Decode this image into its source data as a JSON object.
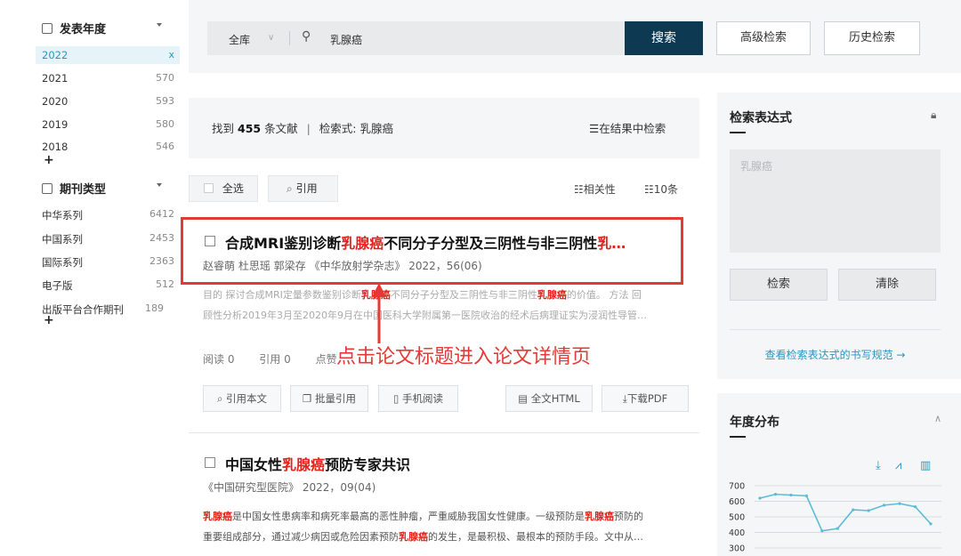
{
  "sidebar": {
    "pub_year": {
      "title": "发表年度",
      "items": [
        {
          "label": "2022",
          "count": "x"
        },
        {
          "label": "2021",
          "count": "570"
        },
        {
          "label": "2020",
          "count": "593"
        },
        {
          "label": "2019",
          "count": "580"
        },
        {
          "label": "2018",
          "count": "546"
        }
      ],
      "more": "+"
    },
    "journal_type": {
      "title": "期刊类型",
      "items": [
        {
          "label": "中华系列",
          "count": "6412"
        },
        {
          "label": "中国系列",
          "count": "2453"
        },
        {
          "label": "国际系列",
          "count": "2363"
        },
        {
          "label": "电子版",
          "count": "512"
        },
        {
          "label": "出版平台合作期刊",
          "count": "189"
        }
      ],
      "more": "+"
    }
  },
  "search": {
    "scope": "全库",
    "query": "乳腺癌",
    "button": "搜索",
    "advanced": "高级检索",
    "history": "历史检索"
  },
  "summary": {
    "found_prefix": "找到",
    "count": "455",
    "found_suffix": "条文献",
    "sep": "|",
    "expr": "检索式: 乳腺癌",
    "within": "在结果中检索"
  },
  "toolbar": {
    "select_all": "全选",
    "cite": "引用",
    "relevance": "相关性",
    "per_page": "10条"
  },
  "results": [
    {
      "title_pre": "合成MRI鉴别诊断",
      "title_hl": "乳腺癌",
      "title_mid": "不同分子分型及三阴性与非三阴性",
      "title_hl2": "乳…",
      "meta": "赵睿萌  杜思瑶  郭梁存  《中华放射学杂志》 2022，56(06)",
      "abstract_1_pre": "目的 探讨合成MRI定量参数鉴别诊断",
      "abstract_1_hl": "乳腺癌",
      "abstract_1_mid": "不同分子分型及三阴性与非三阴性",
      "abstract_1_hl2": "乳腺癌",
      "abstract_1_post": "的价值。 方法 回",
      "abstract_2": "顾性分析2019年3月至2020年9月在中国医科大学附属第一医院收治的经术后病理证实为浸润性导管…",
      "stats_read": "阅读 0",
      "stats_cite": "引用 0",
      "stats_fav": "点赞",
      "actions": {
        "cite": "引用本文",
        "batch": "批量引用",
        "mobile": "手机阅读",
        "html": "全文HTML",
        "pdf": "下载PDF"
      }
    },
    {
      "title_pre": "中国女性",
      "title_hl": "乳腺癌",
      "title_post": "预防专家共识",
      "meta": "《中国研究型医院》 2022，09(04)",
      "abstract_1_hl": "乳腺癌",
      "abstract_1_post": "是中国女性患病率和病死率最高的恶性肿瘤，严重威胁我国女性健康。一级预防是",
      "abstract_1_hl2": "乳腺癌",
      "abstract_1_post2": "预防的",
      "abstract_2_pre": "重要组成部分，通过减少病因或危险因素预防",
      "abstract_2_hl": "乳腺癌",
      "abstract_2_post": "的发生，是最积极、最根本的预防手段。文中从…"
    }
  ],
  "annotation": "点击论文标题进入论文详情页",
  "right_panel": {
    "expr_title": "检索表达式",
    "expr_placeholder": "乳腺癌",
    "search_btn": "检索",
    "clear_btn": "清除",
    "help_link": "查看检索表达式的书写规范 →",
    "dist_title": "年度分布",
    "y_ticks": [
      "700",
      "600",
      "500",
      "400",
      "300"
    ]
  },
  "colors": {
    "accent": "#2a96c0",
    "highlight": "#e0241b",
    "annotation": "#e53935",
    "search_btn": "#0d3a52",
    "line": "#5bbcd6"
  },
  "chart_data": {
    "type": "line",
    "values": [
      620,
      645,
      640,
      635,
      410,
      425,
      545,
      540,
      575,
      585,
      565,
      455
    ],
    "ylim": [
      250,
      720
    ],
    "grid": true
  }
}
